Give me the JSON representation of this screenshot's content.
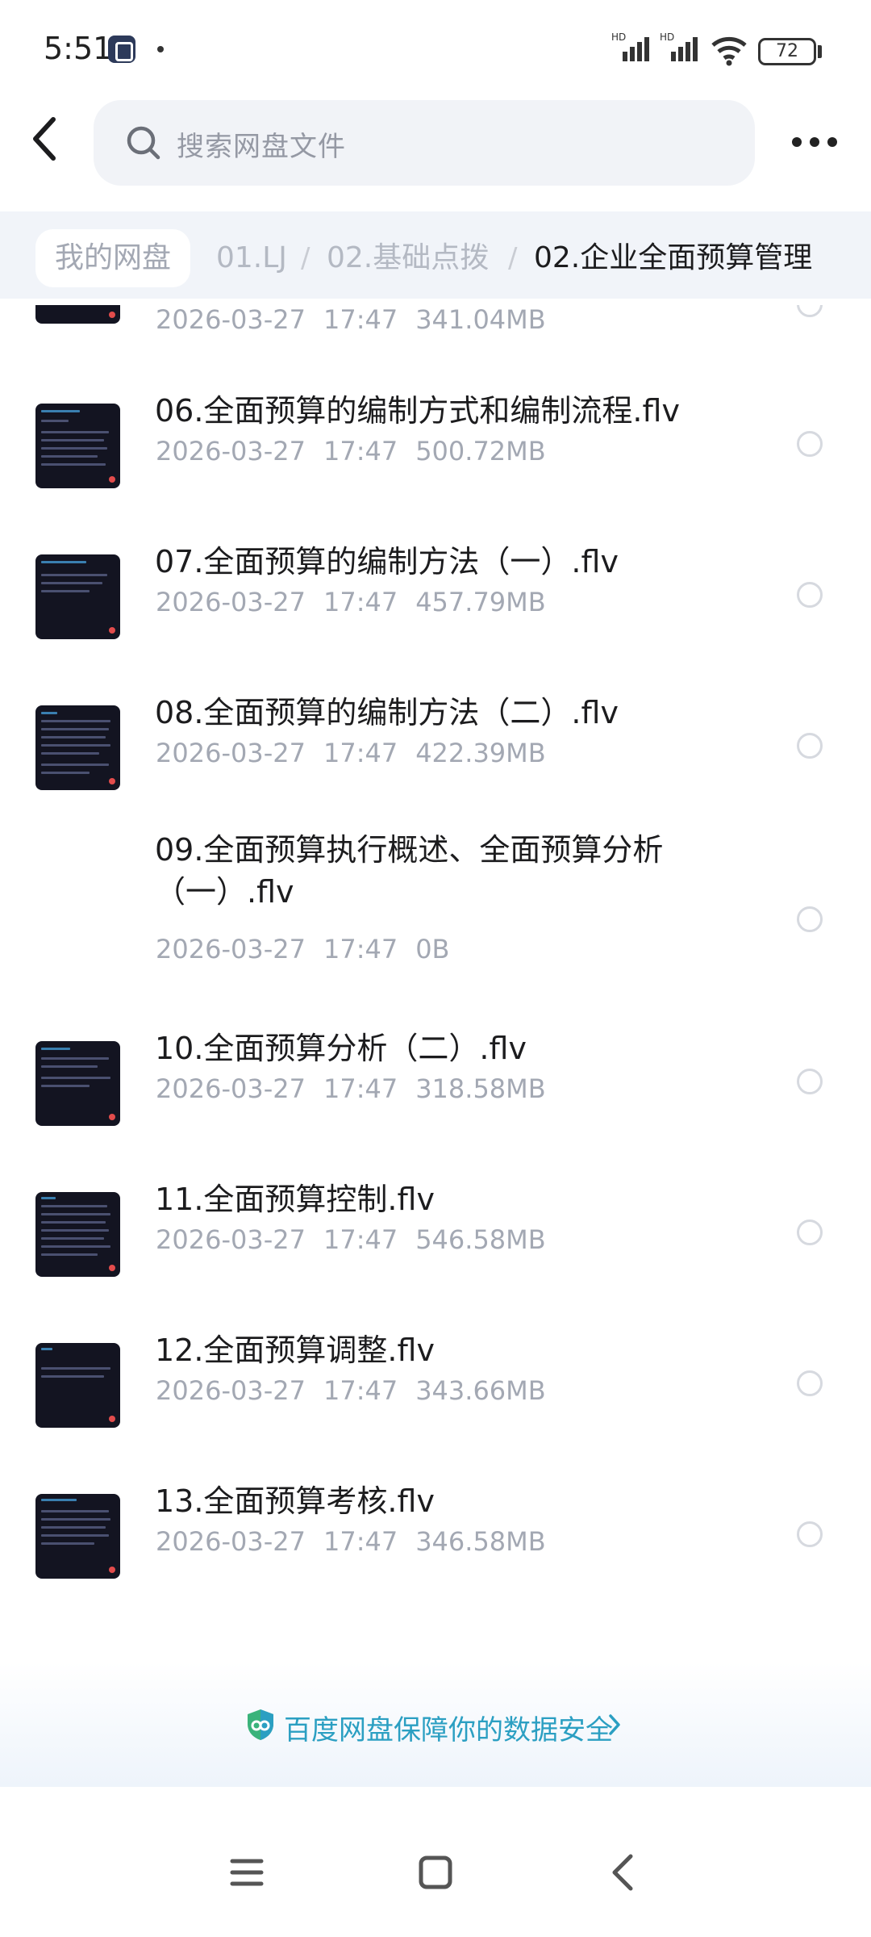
{
  "status_bar": {
    "time": "5:51",
    "battery": "72"
  },
  "header": {
    "search_placeholder": "搜索网盘文件"
  },
  "breadcrumb": [
    {
      "label": "我的网盘"
    },
    {
      "label": "01.LJ"
    },
    {
      "label": "02.基础点拨"
    },
    {
      "label": "02.企业全面预算管理"
    }
  ],
  "files": [
    {
      "name": "",
      "date": "2026-03-27",
      "time": "17:47",
      "size": "341.04MB",
      "has_thumb": true
    },
    {
      "name": "06.全面预算的编制方式和编制流程.flv",
      "date": "2026-03-27",
      "time": "17:47",
      "size": "500.72MB",
      "has_thumb": true
    },
    {
      "name": "07.全面预算的编制方法（一）.flv",
      "date": "2026-03-27",
      "time": "17:47",
      "size": "457.79MB",
      "has_thumb": true
    },
    {
      "name": "08.全面预算的编制方法（二）.flv",
      "date": "2026-03-27",
      "time": "17:47",
      "size": "422.39MB",
      "has_thumb": true
    },
    {
      "name": "09.全面预算执行概述、全面预算分析（一）.flv",
      "date": "2026-03-27",
      "time": "17:47",
      "size": "0B",
      "has_thumb": false
    },
    {
      "name": "10.全面预算分析（二）.flv",
      "date": "2026-03-27",
      "time": "17:47",
      "size": "318.58MB",
      "has_thumb": true
    },
    {
      "name": "11.全面预算控制.flv",
      "date": "2026-03-27",
      "time": "17:47",
      "size": "546.58MB",
      "has_thumb": true
    },
    {
      "name": "12.全面预算调整.flv",
      "date": "2026-03-27",
      "time": "17:47",
      "size": "343.66MB",
      "has_thumb": true
    },
    {
      "name": "13.全面预算考核.flv",
      "date": "2026-03-27",
      "time": "17:47",
      "size": "346.58MB",
      "has_thumb": true
    }
  ],
  "footer": {
    "security_text": "百度网盘保障你的数据安全"
  },
  "colors": {
    "accent": "#2b9fc2",
    "meta_text": "#a3a8b3",
    "thumb_bg": "#131421"
  },
  "icons": [
    "back-icon",
    "search-icon",
    "more-icon",
    "shield-icon",
    "chevron-right-icon",
    "menu-icon",
    "home-icon",
    "nav-back-icon"
  ]
}
